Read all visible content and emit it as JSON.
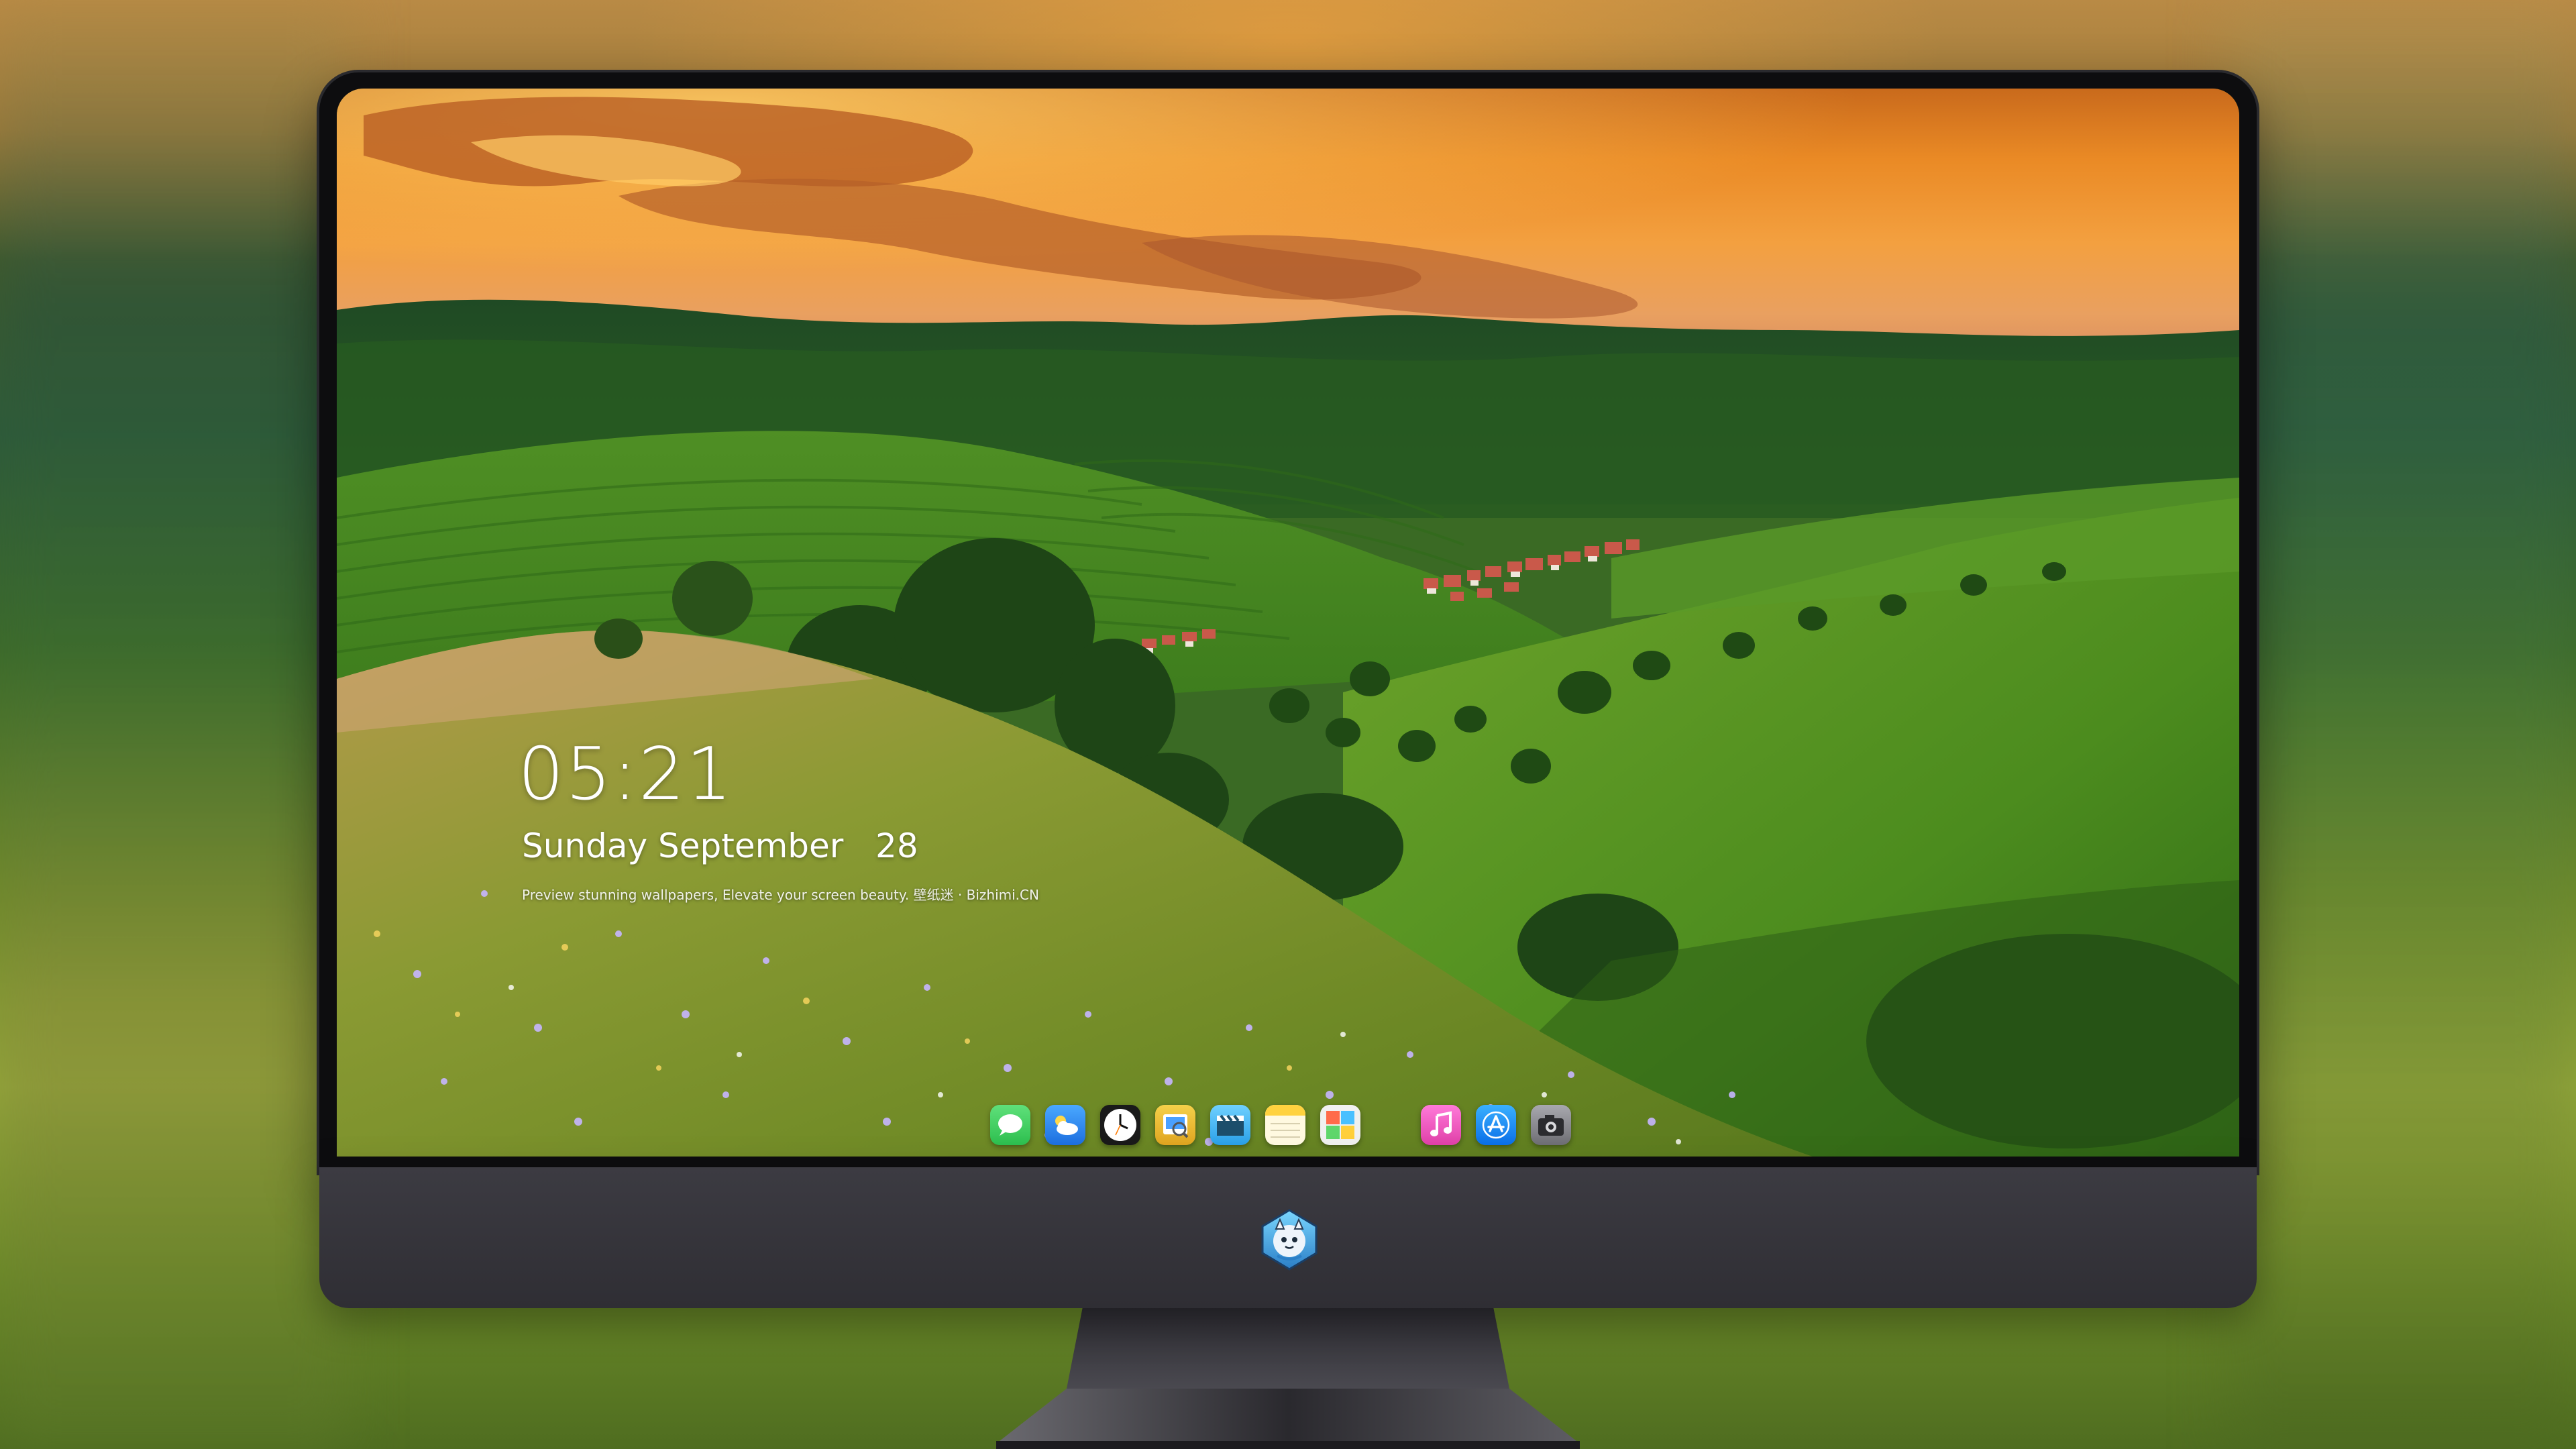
{
  "lockscreen": {
    "time": "05:21",
    "date": "Sunday September   28",
    "tagline": "Preview stunning wallpapers, Elevate your screen beauty. 壁纸迷 · Bizhimi.CN"
  },
  "dock": {
    "apps": [
      {
        "name": "Messages",
        "icon": "messages-icon",
        "color": "#35c759"
      },
      {
        "name": "Weather",
        "icon": "weather-icon",
        "color": "#2f8cf0"
      },
      {
        "name": "Clock",
        "icon": "clock-icon",
        "color": "#ffffff"
      },
      {
        "name": "Preview",
        "icon": "preview-icon",
        "color": "#f2c230"
      },
      {
        "name": "Clips",
        "icon": "clapperboard-icon",
        "color": "#38b6ff"
      },
      {
        "name": "Notes",
        "icon": "notes-icon",
        "color": "#ffd23f"
      },
      {
        "name": "Photo Booth",
        "icon": "photo-booth-icon",
        "color": "#e8e8e8"
      },
      {
        "name": "Music",
        "icon": "music-icon",
        "color": "#fb5bc5"
      },
      {
        "name": "App Store",
        "icon": "app-store-icon",
        "color": "#1a8cff"
      },
      {
        "name": "Camera",
        "icon": "camera-icon",
        "color": "#8e8e93"
      }
    ]
  },
  "colors": {
    "bezel": "#0d0d0f",
    "chin": "#35343a",
    "stand": "#2b2a30"
  }
}
